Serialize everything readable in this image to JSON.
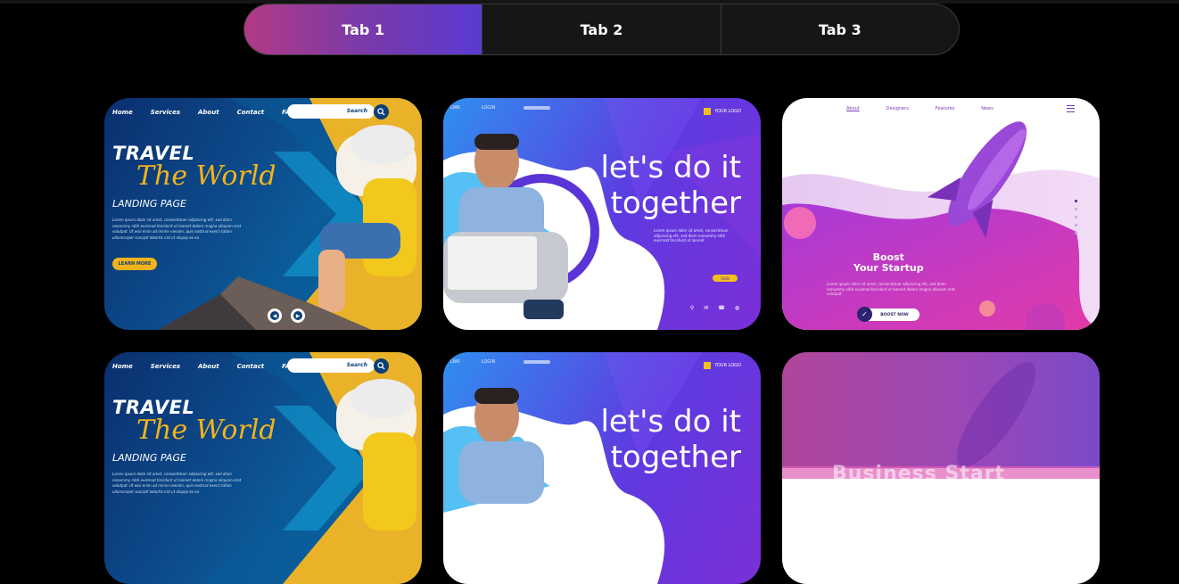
{
  "tabs": [
    {
      "label": "Tab 1",
      "active": true
    },
    {
      "label": "Tab 2",
      "active": false
    },
    {
      "label": "Tab 3",
      "active": false
    }
  ],
  "colors": {
    "background": "#000000",
    "tab_bg": "#161616",
    "tab_active_start": "#b23a86",
    "tab_active_end": "#5a3ad2",
    "travel_accent": "#f3b41a",
    "travel_navy": "#0c3f77",
    "startup_pink": "#d03ec0"
  },
  "travel_card": {
    "nav": [
      "Home",
      "Services",
      "About",
      "Contact",
      "FAQ"
    ],
    "search_text": "Search",
    "title": "TRAVEL",
    "script_title": "The World",
    "subtitle": "LANDING PAGE",
    "body": "Lorem ipsum dolor sit amet, consectetuer adipiscing elit, sed diam nonummy nibh euismod tincidunt ut laoreet dolore magna aliquam erat volutpat. Ut wisi enim ad minim veniam, quis nostrud exerci tation ullamcorper suscipit lobortis nisl ut aliquip ex ea",
    "button": "LEARN MORE",
    "prev_icon": "chevron-left-icon",
    "next_icon": "chevron-right-icon"
  },
  "together_card": {
    "nav": [
      "LWR",
      "LOGIN"
    ],
    "logo_text": "YOUR LOGO",
    "headline_line1": "let's do it",
    "headline_line2": "together",
    "body": "Lorem ipsum dolor sit amet, consectetuer adipiscing elit, sed diam nonummy nibh euismod tincidunt ut laoreet",
    "button": "SIGN",
    "social_icons": [
      "location-icon",
      "mail-icon",
      "phone-icon",
      "globe-icon"
    ]
  },
  "startup_card": {
    "nav": [
      "About",
      "Designers",
      "Features",
      "News"
    ],
    "headline_line1": "Boost",
    "headline_line2": "Your Startup",
    "body": "Lorem ipsum dolor sit amet, consectetuer adipiscing elit, sed diam nonummy nibh euismod tincidunt ut laoreet dolore magna aliquam erat volutpat",
    "button": "BOOST NOW"
  },
  "row2_startup_overlay": "Business Start"
}
